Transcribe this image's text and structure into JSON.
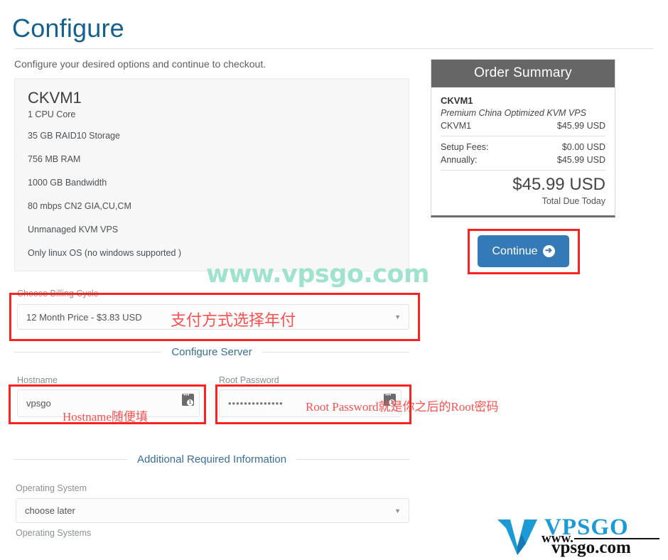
{
  "header": {
    "title": "Configure",
    "intro": "Configure your desired options and continue to checkout."
  },
  "product": {
    "name": "CKVM1",
    "cpu": "1 CPU Core",
    "specs": [
      "35 GB RAID10 Storage",
      "756 MB RAM",
      "1000 GB Bandwidth",
      "80 mbps CN2 GIA,CU,CM",
      "Unmanaged KVM VPS",
      "Only linux OS (no windows supported )"
    ]
  },
  "order_summary": {
    "heading": "Order Summary",
    "product_name": "CKVM1",
    "product_desc": "Premium China Optimized KVM VPS",
    "line_item_label": "CKVM1",
    "line_item_price": "$45.99 USD",
    "setup_label": "Setup Fees:",
    "setup_value": "$0.00 USD",
    "cycle_label": "Annually:",
    "cycle_value": "$45.99 USD",
    "total_amount": "$45.99 USD",
    "total_label": "Total Due Today",
    "continue_label": "Continue",
    "continue_icon": "arrow-right-circle-icon"
  },
  "billing": {
    "label": "Choose Billing Cycle",
    "selected": "12 Month Price - $3.83 USD",
    "caret": "▼"
  },
  "sections": {
    "configure_server": "Configure Server",
    "additional_info": "Additional Required Information"
  },
  "fields": {
    "hostname_label": "Hostname",
    "hostname_value": "vpsgo",
    "hostname_placeholder": "Hostname",
    "root_password_label": "Root Password",
    "root_password_value": "••••••••••••••",
    "root_password_placeholder": "Root Password",
    "password_manager_icon": "lastpass-icon"
  },
  "operating_system": {
    "label": "Operating System",
    "selected": "choose later",
    "caret": "▼",
    "helptext": "Operating Systems"
  },
  "annotations": {
    "billing_note": "支付方式选择年付",
    "hostname_note": "Hostname随便填",
    "password_note": "Root Password就是你之后的Root密码"
  },
  "watermarks": {
    "green_text": "www.vpsgo.com",
    "logo_top": "VPSGO",
    "logo_www": "www.",
    "logo_domain": "vpsgo.com"
  },
  "colors": {
    "title_blue": "#16608f",
    "accent_blue": "#337ab7",
    "annotation_red": "#fb2222",
    "summary_header_gray": "#666666",
    "watermark_green": "#9fe2ce",
    "logo_blue": "#1b9ad6"
  }
}
